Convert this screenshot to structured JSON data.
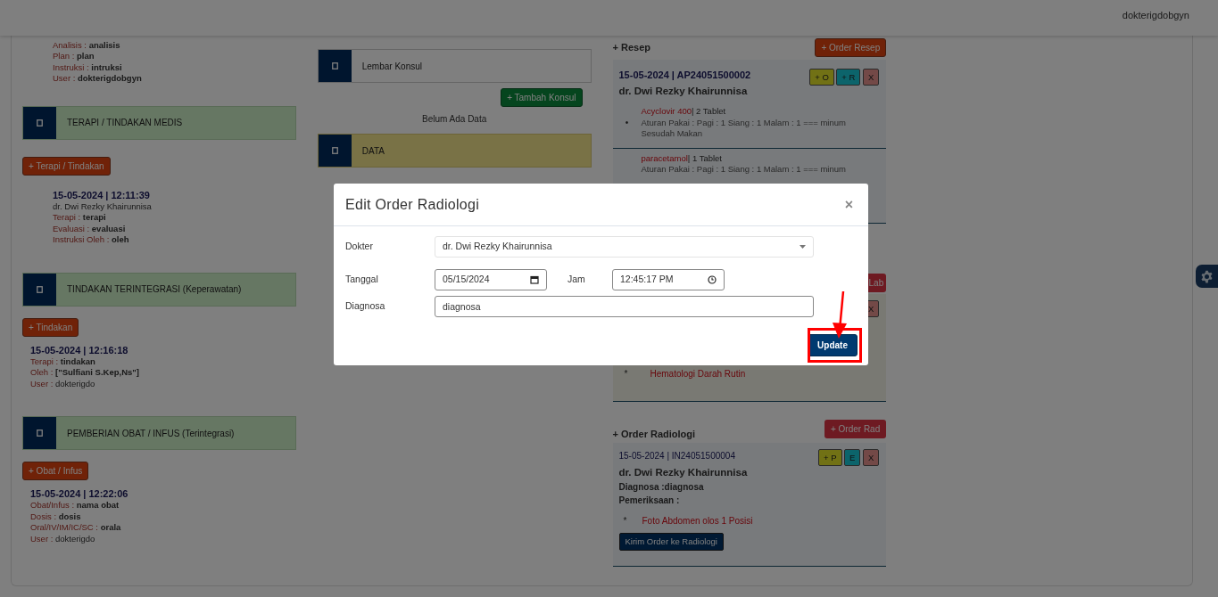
{
  "navbar": {
    "user": "dokterigdobgyn"
  },
  "left": {
    "soap_lines": [
      {
        "label": "Analisis :",
        "value": "analisis",
        "bold": true
      },
      {
        "label": "Plan :",
        "value": "plan",
        "bold": true
      },
      {
        "label": "Instruksi :",
        "value": "intruksi",
        "bold": true
      },
      {
        "label": "User :",
        "value": "dokterigdobgyn",
        "bold": true
      }
    ],
    "sections": [
      {
        "title": "TERAPI / TINDAKAN MEDIS",
        "button": "+ Terapi / Tindakan",
        "entry": {
          "heading": "15-05-2024 | 12:11:39",
          "doctor": "dr. Dwi Rezky Khairunnisa",
          "lines": [
            {
              "label": "Terapi :",
              "value": "terapi",
              "bold": true
            },
            {
              "label": "Evaluasi :",
              "value": "evaluasi",
              "bold": true
            },
            {
              "label": "Instruksi Oleh :",
              "value": "oleh",
              "bold": true
            }
          ]
        }
      },
      {
        "title": "TINDAKAN TERINTEGRASI (Keperawatan)",
        "button": "+ Tindakan",
        "entry": {
          "heading": "15-05-2024 | 12:16:18",
          "lines": [
            {
              "label": "Terapi :",
              "value": "tindakan",
              "bold": true
            },
            {
              "label": "Oleh :",
              "value": "[\"Sulfiani S.Kep,Ns\"]",
              "bold": true
            },
            {
              "label": "User :",
              "value": "dokterigdo",
              "bold": false
            }
          ]
        }
      },
      {
        "title": "PEMBERIAN OBAT / INFUS (Terintegrasi)",
        "button": "+ Obat / Infus",
        "entry": {
          "heading": "15-05-2024 | 12:22:06",
          "lines": [
            {
              "label": "Obat/Infus :",
              "value": "nama obat",
              "bold": true
            },
            {
              "label": "Dosis :",
              "value": "dosis",
              "bold": true
            },
            {
              "label": "Oral/IV/IM/IC/SC :",
              "value": "orala",
              "bold": true
            },
            {
              "label": "User :",
              "value": "dokterigdo",
              "bold": false
            }
          ]
        }
      }
    ]
  },
  "middle": {
    "konsul_panel": "Lembar Konsul",
    "konsul_button": "+ Tambah Konsul",
    "empty_text": "Belum Ada Data",
    "data_panel": "DATA"
  },
  "right": {
    "resep": {
      "title": "+ Resep",
      "button": "+ Order Resep",
      "card": {
        "heading": "15-05-2024 | AP24051500002",
        "doctor": "dr. Dwi Rezky Khairunnisa",
        "actions": [
          {
            "label": "+ O",
            "kind": "olive"
          },
          {
            "label": "+ R",
            "kind": "teal"
          },
          {
            "label": "X",
            "kind": "delete"
          }
        ],
        "items": [
          {
            "bullet": "•",
            "drug": "Acyclovir 400",
            "qty": "| 2 Tablet",
            "rule": "Aturan Pakai : Pagi : 1 Siang : 1 Malam : 1 === minum Sesudah Makan"
          },
          {
            "drug": "paracetamol",
            "qty": "| 1 Tablet",
            "rule": "Aturan Pakai : Pagi : 1 Siang : 1 Malam : 1 === minum"
          }
        ]
      }
    },
    "lab": {
      "button": "Lab",
      "actions": [
        {
          "label": "X",
          "kind": "delete"
        }
      ],
      "items": [
        {
          "bullet": "*",
          "name": "Hematologi Darah Rutin"
        }
      ]
    },
    "radiologi": {
      "title": "+ Order Radiologi",
      "button": "+ Order Rad",
      "card": {
        "heading": "15-05-2024 | IN24051500004",
        "doctor": "dr. Dwi Rezky Khairunnisa",
        "diagnosa": "Diagnosa :diagnosa",
        "pemeriksaan": "Pemeriksaan :",
        "actions": [
          {
            "label": "+ P",
            "kind": "olive"
          },
          {
            "label": "E",
            "kind": "teal"
          },
          {
            "label": "X",
            "kind": "delete"
          }
        ],
        "items": [
          {
            "bullet": "*",
            "name": "Foto Abdomen olos 1 Posisi"
          }
        ],
        "send_button": "Kirim Order ke Radiologi"
      }
    }
  },
  "modal": {
    "title": "Edit Order Radiologi",
    "close": "×",
    "rows": [
      {
        "label": "Dokter",
        "kind": "select",
        "value": "dr. Dwi Rezky Khairunnisa"
      },
      {
        "label": "Tanggal",
        "kind": "date",
        "value": "05/15/2024",
        "extra": {
          "label": "Jam",
          "kind": "time",
          "value": "12:45:17 PM"
        }
      },
      {
        "label": "Diagnosa",
        "kind": "text",
        "value": "diagnosa"
      }
    ],
    "button": "Update"
  },
  "annotation": {
    "kind": "arrow-box"
  }
}
